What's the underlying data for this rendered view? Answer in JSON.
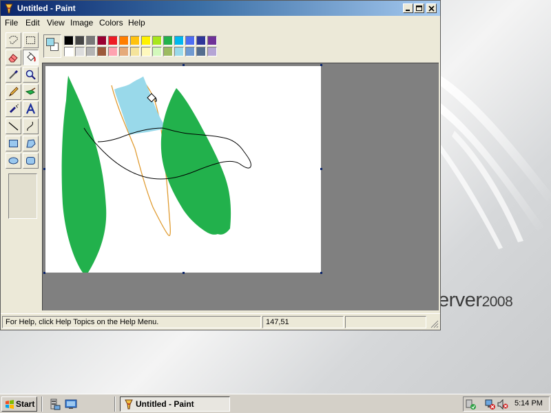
{
  "window": {
    "title": "Untitled - Paint",
    "controls": {
      "minimize": "minimize",
      "maximize": "maximize",
      "close": "close"
    }
  },
  "menu": [
    "File",
    "Edit",
    "View",
    "Image",
    "Colors",
    "Help"
  ],
  "tools": [
    {
      "name": "free-form-select",
      "icon": "free-select-icon"
    },
    {
      "name": "select",
      "icon": "rect-select-icon"
    },
    {
      "name": "eraser",
      "icon": "eraser-icon"
    },
    {
      "name": "fill-with-color",
      "icon": "paint-bucket-icon",
      "selected": true
    },
    {
      "name": "pick-color",
      "icon": "eyedropper-icon"
    },
    {
      "name": "magnifier",
      "icon": "magnifier-icon"
    },
    {
      "name": "pencil",
      "icon": "pencil-icon"
    },
    {
      "name": "brush",
      "icon": "brush-icon"
    },
    {
      "name": "airbrush",
      "icon": "airbrush-icon"
    },
    {
      "name": "text",
      "icon": "text-icon"
    },
    {
      "name": "line",
      "icon": "line-icon"
    },
    {
      "name": "curve",
      "icon": "curve-icon"
    },
    {
      "name": "rectangle",
      "icon": "rectangle-icon"
    },
    {
      "name": "polygon",
      "icon": "polygon-icon"
    },
    {
      "name": "ellipse",
      "icon": "ellipse-icon"
    },
    {
      "name": "rounded-rectangle",
      "icon": "rounded-rect-icon"
    }
  ],
  "palette": {
    "foreground": "#99d9ea",
    "background": "#ffffff",
    "top_row": [
      "#000000",
      "#464646",
      "#787878",
      "#990030",
      "#ed1c24",
      "#ff7e00",
      "#ffc20e",
      "#fff200",
      "#a8e61d",
      "#22b14c",
      "#00b7ef",
      "#4d6df3",
      "#2f3699",
      "#6f3198"
    ],
    "bottom_row": [
      "#ffffff",
      "#dcdcdc",
      "#b4b4b4",
      "#9c5a3c",
      "#ffa3b1",
      "#e5aa7a",
      "#f5e49c",
      "#fff9bd",
      "#d3f9bc",
      "#9dbb61",
      "#99d9ea",
      "#709ad1",
      "#546d8e",
      "#b5a5d5"
    ]
  },
  "canvas": {
    "background": "#ffffff",
    "fill_colors": {
      "green": "#22b14c",
      "light_blue": "#99d9ea",
      "orange": "#e09b30",
      "black": "#000000"
    }
  },
  "statusbar": {
    "help_text": "For Help, click Help Topics on the Help Menu.",
    "coordinates": "147,51",
    "size": ""
  },
  "desktop": {
    "brand_text": "erver",
    "brand_year": "2008"
  },
  "taskbar": {
    "start_label": "Start",
    "quick_launch": [
      "server-manager-icon",
      "show-desktop-icon"
    ],
    "active_task": "Untitled - Paint",
    "tray_icons": [
      "security-icon",
      "network-error-icon",
      "volume-muted-icon"
    ],
    "clock": "5:14 PM"
  }
}
